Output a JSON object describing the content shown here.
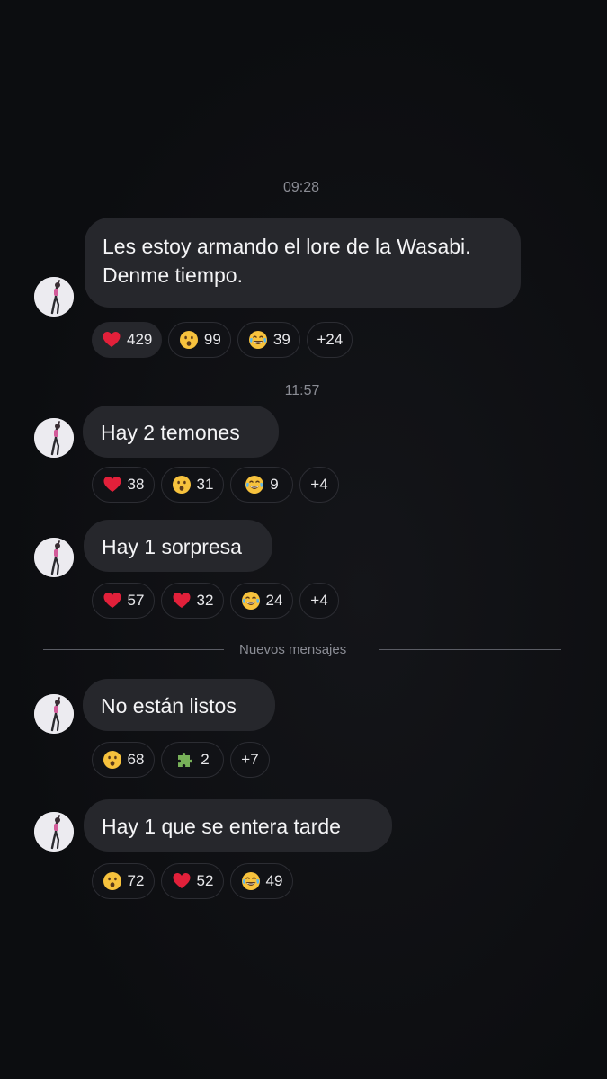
{
  "messages": [
    {
      "time": "09:28",
      "lines": [
        "Les estoy armando el lore de la Wasabi.",
        "Denme tiempo."
      ],
      "reactions": [
        {
          "emoji": "heart-icon",
          "count": "429",
          "active": true
        },
        {
          "emoji": "surprised-face-icon",
          "count": "99"
        },
        {
          "emoji": "crying-laughing-face-icon",
          "count": "39"
        },
        {
          "emoji": "",
          "count": "+24"
        }
      ]
    },
    {
      "time": "11:57",
      "lines": [
        "Hay 2 temones"
      ],
      "reactions": [
        {
          "emoji": "heart-icon",
          "count": "38"
        },
        {
          "emoji": "surprised-face-icon",
          "count": "31"
        },
        {
          "emoji": "crying-laughing-face-icon",
          "count": "9"
        },
        {
          "emoji": "",
          "count": "+4"
        }
      ]
    },
    {
      "lines": [
        "Hay 1 sorpresa"
      ],
      "reactions": [
        {
          "emoji": "heart-icon",
          "count": "57"
        },
        {
          "emoji": "heart-icon",
          "count": "32"
        },
        {
          "emoji": "crying-laughing-face-icon",
          "count": "24"
        },
        {
          "emoji": "",
          "count": "+4"
        }
      ]
    },
    {
      "lines": [
        "No están listos"
      ],
      "reactions": [
        {
          "emoji": "surprised-face-icon",
          "count": "68"
        },
        {
          "emoji": "puzzle-piece-icon",
          "count": "2"
        },
        {
          "emoji": "",
          "count": "+7"
        }
      ]
    },
    {
      "lines": [
        "Hay 1 que se entera tarde"
      ],
      "reactions": [
        {
          "emoji": "surprised-face-icon",
          "count": "72"
        },
        {
          "emoji": "heart-icon",
          "count": "52"
        },
        {
          "emoji": "crying-laughing-face-icon",
          "count": "49"
        }
      ]
    }
  ],
  "divider": {
    "label": "Nuevos mensajes"
  },
  "colors": {
    "background": "#0c0d10",
    "bubble": "#26272c",
    "muted_text": "#8a8c94",
    "heart": "#e2203a",
    "emoji_yellow": "#f7c23d",
    "puzzle_green": "#78b159"
  }
}
